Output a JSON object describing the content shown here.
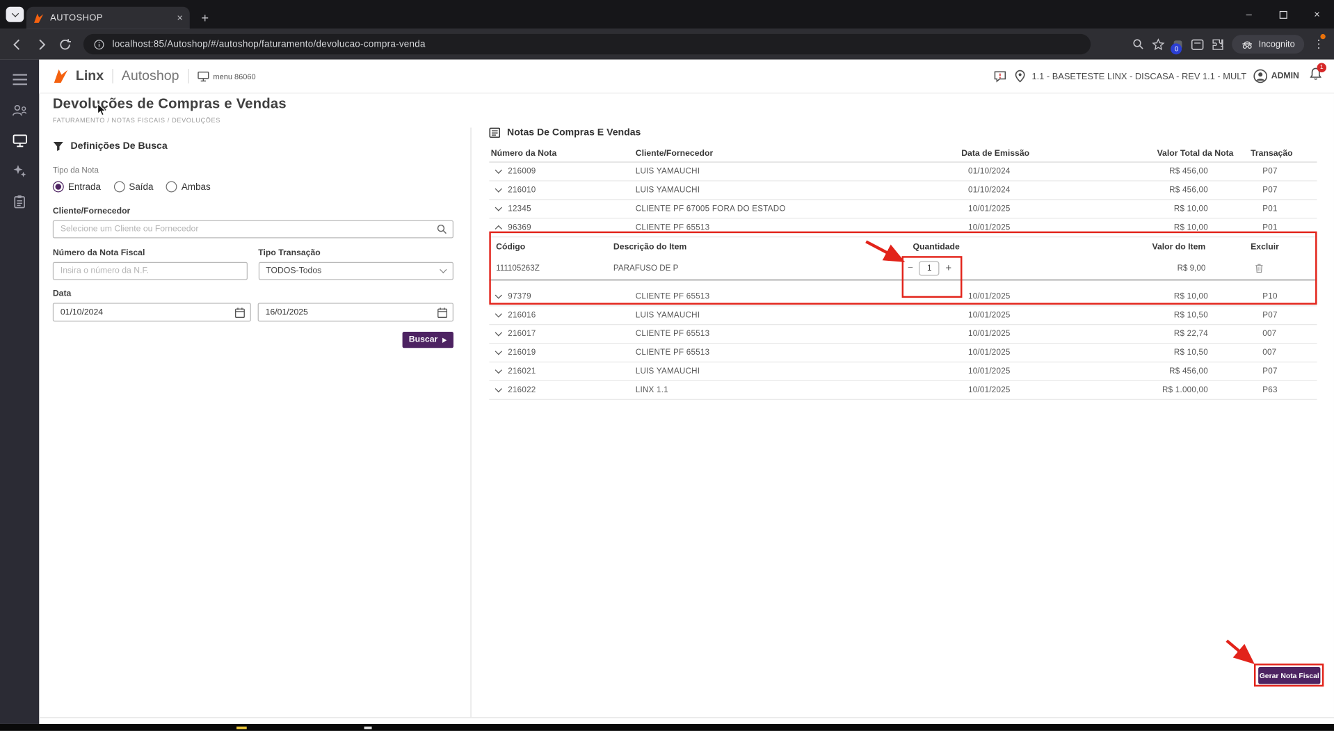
{
  "browser": {
    "tab": {
      "title": "AUTOSHOP"
    },
    "url": "localhost:85/Autoshop/#/autoshop/faturamento/devolucao-compra-venda",
    "incognito_label": "Incognito",
    "extension_badge": "0"
  },
  "icons": {
    "tab_close": "×",
    "new_tab": "+",
    "window_minimize": "–",
    "window_close": "×",
    "stepper_minus": "−",
    "stepper_plus": "+",
    "menu_dots": "⋮"
  },
  "app_header": {
    "brand": "Linx",
    "product": "Autoshop",
    "menu_label": "menu 86060",
    "environment": "1.1 - BASETESTE LINX - DISCASA - REV 1.1 - MULT",
    "user_label": "ADMIN",
    "notification_count": "1"
  },
  "page": {
    "title": "Devoluções de Compras e Vendas",
    "breadcrumb": "FATURAMENTO / NOTAS FISCAIS / DEVOLUÇÕES"
  },
  "search_panel": {
    "title": "Definições De Busca",
    "tipo_nota_label": "Tipo da Nota",
    "radios": [
      {
        "label": "Entrada",
        "selected": true
      },
      {
        "label": "Saída",
        "selected": false
      },
      {
        "label": "Ambas",
        "selected": false
      }
    ],
    "cliente_label": "Cliente/Fornecedor",
    "cliente_placeholder": "Selecione um Cliente ou Fornecedor",
    "nf_label": "Número da Nota Fiscal",
    "nf_placeholder": "Insira o número da N.F.",
    "transacao_label": "Tipo Transação",
    "transacao_value": "TODOS-Todos",
    "data_label": "Data",
    "date_start": "01/10/2024",
    "date_end": "16/01/2025",
    "buscar_label": "Buscar"
  },
  "notes_panel": {
    "title": "Notas De Compras E Vendas",
    "columns": {
      "numero": "Número da Nota",
      "cliente": "Cliente/Fornecedor",
      "data": "Data de Emissão",
      "valor": "Valor Total da Nota",
      "transacao": "Transação"
    },
    "rows_top": [
      {
        "numero": "216009",
        "cliente": "LUIS YAMAUCHI",
        "data": "01/10/2024",
        "valor": "R$ 456,00",
        "transacao": "P07"
      },
      {
        "numero": "216010",
        "cliente": "LUIS YAMAUCHI",
        "data": "01/10/2024",
        "valor": "R$ 456,00",
        "transacao": "P07"
      },
      {
        "numero": "12345",
        "cliente": "CLIENTE PF 67005 FORA DO ESTADO",
        "data": "10/01/2025",
        "valor": "R$ 10,00",
        "transacao": "P01"
      }
    ],
    "expanded_row": {
      "numero": "96369",
      "cliente": "CLIENTE PF 65513",
      "data": "10/01/2025",
      "valor": "R$ 10,00",
      "transacao": "P01"
    },
    "item_columns": {
      "codigo": "Código",
      "descricao": "Descrição do Item",
      "quantidade": "Quantidade",
      "valor": "Valor do Item",
      "excluir": "Excluir"
    },
    "item": {
      "codigo": "111105263Z",
      "descricao": "PARAFUSO DE P",
      "quantidade": "1",
      "valor": "R$ 9,00"
    },
    "rows_bottom": [
      {
        "numero": "97379",
        "cliente": "CLIENTE PF 65513",
        "data": "10/01/2025",
        "valor": "R$ 10,00",
        "transacao": "P10"
      },
      {
        "numero": "216016",
        "cliente": "LUIS YAMAUCHI",
        "data": "10/01/2025",
        "valor": "R$ 10,50",
        "transacao": "P07"
      },
      {
        "numero": "216017",
        "cliente": "CLIENTE PF 65513",
        "data": "10/01/2025",
        "valor": "R$ 22,74",
        "transacao": "007"
      },
      {
        "numero": "216019",
        "cliente": "CLIENTE PF 65513",
        "data": "10/01/2025",
        "valor": "R$ 10,50",
        "transacao": "007"
      },
      {
        "numero": "216021",
        "cliente": "LUIS YAMAUCHI",
        "data": "10/01/2025",
        "valor": "R$ 456,00",
        "transacao": "P07"
      },
      {
        "numero": "216022",
        "cliente": "LINX 1.1",
        "data": "10/01/2025",
        "valor": "R$ 1.000,00",
        "transacao": "P63"
      }
    ],
    "gerar_button": "Gerar Nota Fiscal"
  },
  "colors": {
    "accent_purple": "#4d2362",
    "brand_orange": "#f4610f",
    "annotation_red": "#e2231a",
    "sidebar_dark": "#2b2b34"
  }
}
